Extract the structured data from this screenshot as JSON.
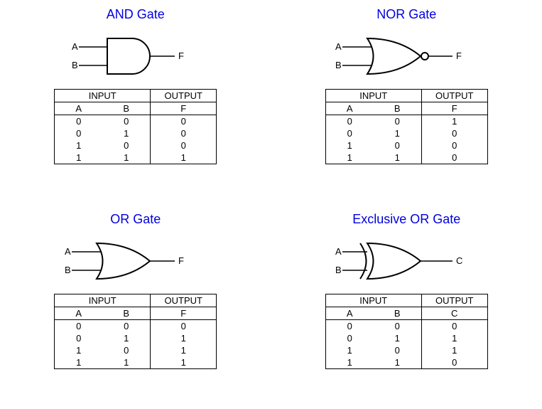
{
  "gates": [
    {
      "title": "AND Gate",
      "inputs": [
        "A",
        "B"
      ],
      "output": "F",
      "headers": {
        "input": "INPUT",
        "output": "OUTPUT"
      },
      "rows": [
        {
          "a": "0",
          "b": "0",
          "f": "0"
        },
        {
          "a": "0",
          "b": "1",
          "f": "0"
        },
        {
          "a": "1",
          "b": "0",
          "f": "0"
        },
        {
          "a": "1",
          "b": "1",
          "f": "1"
        }
      ]
    },
    {
      "title": "NOR Gate",
      "inputs": [
        "A",
        "B"
      ],
      "output": "F",
      "headers": {
        "input": "INPUT",
        "output": "OUTPUT"
      },
      "rows": [
        {
          "a": "0",
          "b": "0",
          "f": "1"
        },
        {
          "a": "0",
          "b": "1",
          "f": "0"
        },
        {
          "a": "1",
          "b": "0",
          "f": "0"
        },
        {
          "a": "1",
          "b": "1",
          "f": "0"
        }
      ]
    },
    {
      "title": "OR Gate",
      "inputs": [
        "A",
        "B"
      ],
      "output": "F",
      "headers": {
        "input": "INPUT",
        "output": "OUTPUT"
      },
      "rows": [
        {
          "a": "0",
          "b": "0",
          "f": "0"
        },
        {
          "a": "0",
          "b": "1",
          "f": "1"
        },
        {
          "a": "1",
          "b": "0",
          "f": "1"
        },
        {
          "a": "1",
          "b": "1",
          "f": "1"
        }
      ]
    },
    {
      "title": "Exclusive OR Gate",
      "inputs": [
        "A",
        "B"
      ],
      "output": "C",
      "headers": {
        "input": "INPUT",
        "output": "OUTPUT"
      },
      "rows": [
        {
          "a": "0",
          "b": "0",
          "f": "0"
        },
        {
          "a": "0",
          "b": "1",
          "f": "1"
        },
        {
          "a": "1",
          "b": "0",
          "f": "1"
        },
        {
          "a": "1",
          "b": "1",
          "f": "0"
        }
      ]
    }
  ]
}
